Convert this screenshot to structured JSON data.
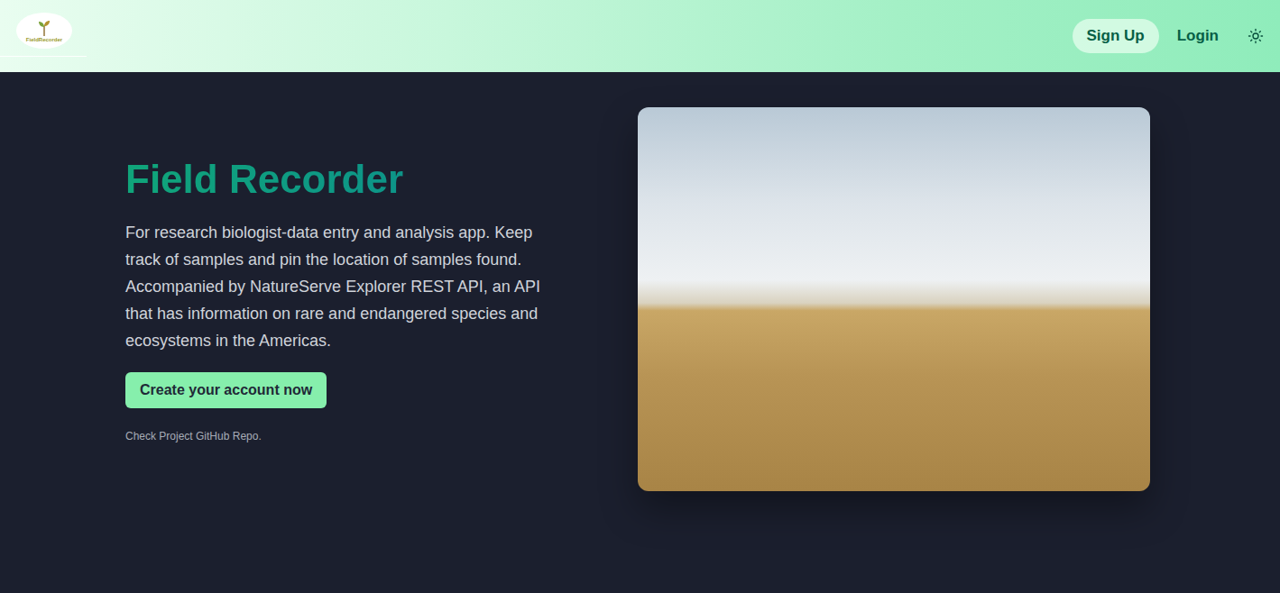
{
  "header": {
    "logo": "FieldRecorder",
    "buttons": [
      {
        "label": "Sign Up",
        "kind": "pill"
      },
      {
        "label": "Login",
        "kind": "link"
      }
    ]
  },
  "hero": {
    "title": "Field Recorder",
    "description": "For research biologist-data entry and analysis app. Keep track of samples and pin the location of samples found. Accompanied by NatureServe Explorer REST API, an API that has information on rare and endangered species and ecosystems in the Americas.",
    "cta": "Create your account now",
    "link": "Check Project GitHub Repo."
  }
}
